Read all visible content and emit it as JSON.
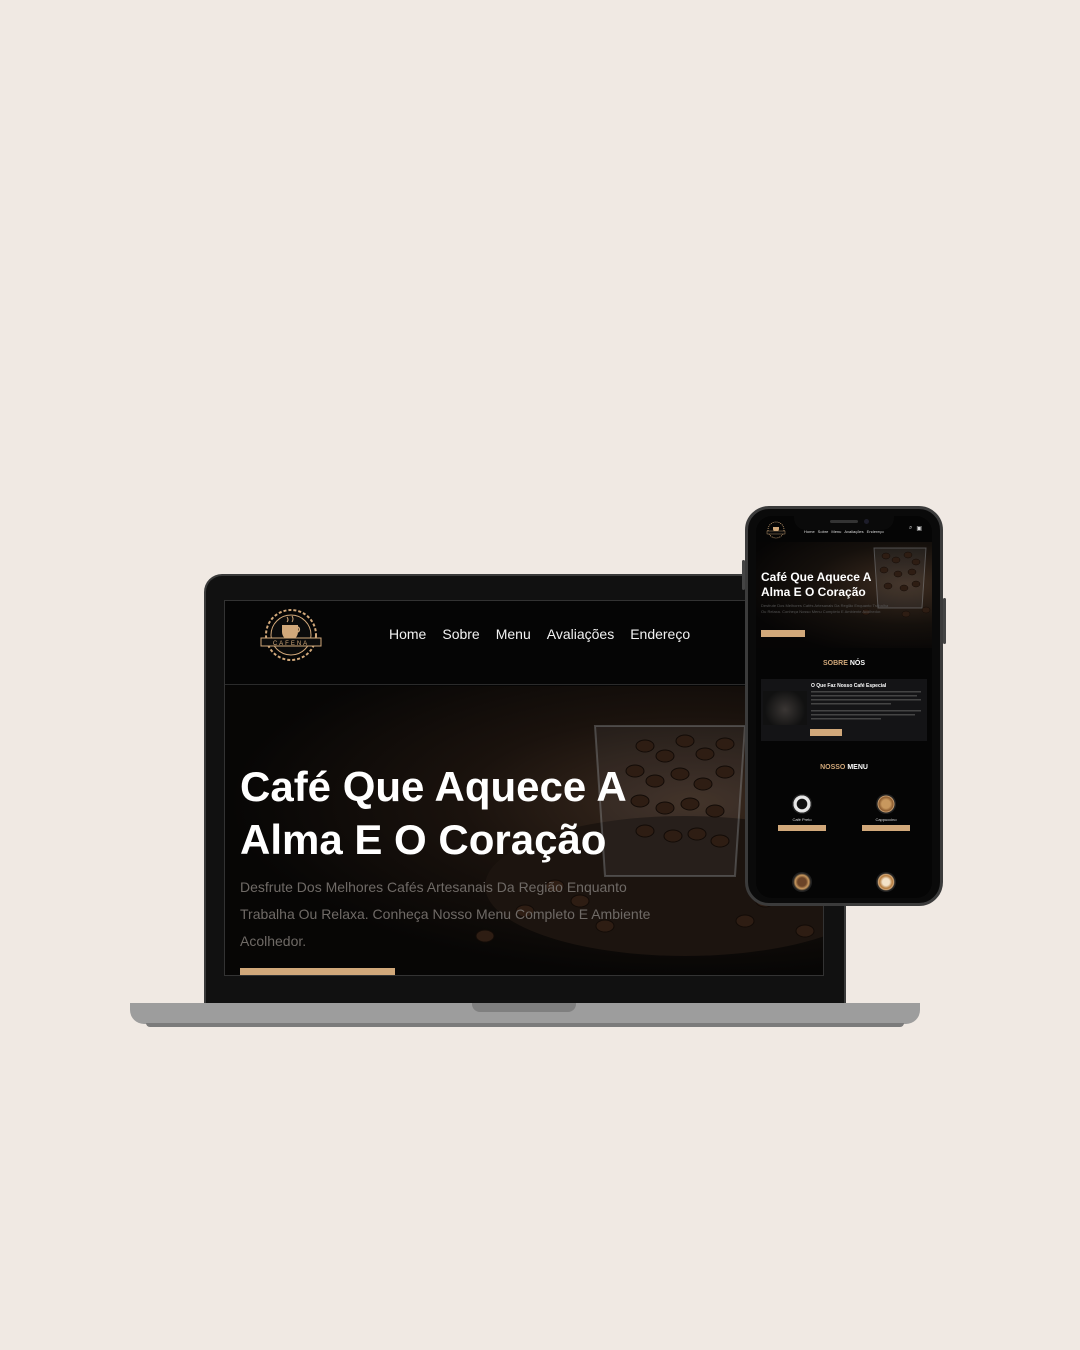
{
  "brand": {
    "name": "CAFENA"
  },
  "nav": [
    "Home",
    "Sobre",
    "Menu",
    "Avaliações",
    "Endereço"
  ],
  "hero": {
    "title": "Café Que Aquece A Alma E O Coração",
    "subtitle": "Desfrute Dos Melhores Cafés Artesanais Da Região Enquanto Trabalha Ou Relaxa. Conheça Nosso Menu Completo E Ambiente Acolhedor."
  },
  "mobile": {
    "about_heading": {
      "accent": "SOBRE",
      "rest": "NÓS"
    },
    "about_card_title": "O Que Faz Nosso Café Especial",
    "menu_heading": {
      "accent": "NOSSO",
      "rest": "MENU"
    },
    "menu_items": [
      {
        "name": "Café Preto"
      },
      {
        "name": "Cappuccino"
      }
    ]
  },
  "colors": {
    "accent": "#d1a87a",
    "background": "#f0e9e3",
    "screen": "#050505"
  }
}
